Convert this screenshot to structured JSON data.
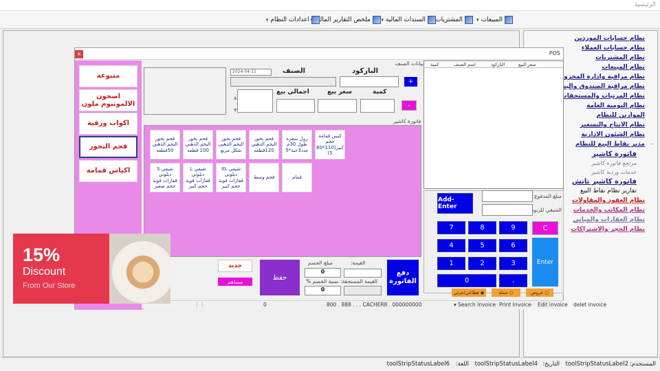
{
  "window": {
    "title": "الرئيسية"
  },
  "menu": {
    "items": [
      {
        "label": "المبيعات",
        "icon": "report-icon"
      },
      {
        "label": "المشتريات",
        "icon": "report-icon"
      },
      {
        "label": "السندات المالية",
        "icon": "report-icon"
      },
      {
        "label": "ملخص التقارير المالية",
        "icon": "report-icon"
      },
      {
        "label": "اعدادات النظام",
        "icon": "report-icon"
      }
    ]
  },
  "tree": {
    "items": [
      {
        "label": "نظام حسابات الموردين",
        "style": ""
      },
      {
        "label": "نظام حسابات العملاء",
        "style": ""
      },
      {
        "label": "نظام المشتريات",
        "style": ""
      },
      {
        "label": "نظام المبيعات",
        "style": ""
      },
      {
        "label": "نظام مراقبة وادارة المخزون",
        "style": ""
      },
      {
        "label": "نظام مراقبة الصندوق والبنوك",
        "style": ""
      },
      {
        "label": "نظام المرتبات والمستحقات",
        "style": ""
      },
      {
        "label": "نظام اليومية العامة",
        "style": ""
      },
      {
        "label": "الموازين للنظام",
        "style": ""
      },
      {
        "label": "نظام الانتاج والتسعير",
        "style": ""
      },
      {
        "label": "نظام الشئون الادارية",
        "style": ""
      },
      {
        "label": "مدير نقاط البيع للنظام",
        "style": ""
      },
      {
        "label": "فاتورة كاشير",
        "style": "sub"
      },
      {
        "label": "مرتجع فاتورة كاشير",
        "style": "sub gray"
      },
      {
        "label": "خدمات وردية كاشير",
        "style": "sub gray"
      },
      {
        "label": "فاتورة كاشير تاتش",
        "style": "sub"
      },
      {
        "label": "تقارير نظام نقاط البيع",
        "style": "sub dark"
      },
      {
        "label": "نظام العقود والمقاولات",
        "style": "red"
      },
      {
        "label": "نظام المكاتب والخدمات",
        "style": "pinkish"
      },
      {
        "label": "نظام العقارات والمباني",
        "style": "gray"
      },
      {
        "label": "نظام الحجز والاشتراكات",
        "style": "pinkish"
      }
    ]
  },
  "statusbar": {
    "user_label": "المستخدم:",
    "user_value": "toolStripStatusLabel2",
    "date_label": "التاريخ:",
    "date_value": "toolStripStatusLabel4",
    "lang_label": "اللغة:",
    "lang_value": "toolStripStatusLabel6"
  },
  "pos": {
    "title": "POS",
    "close": "×",
    "categories": [
      "متنوعة",
      "اصحون الالمونيوم ملون",
      "اكواب ورقية",
      "فحم النحور",
      "اكياس قمامة"
    ],
    "active_category": 3,
    "item_data_label": "بيانات الصنف",
    "barcode_label": "الباركود",
    "item_label": "الصنف",
    "date_value": "2024-04-11",
    "qty_label": "كمية",
    "price_label": "سعر بيع",
    "total_label": "اجمالي بيع",
    "plus_button": "+",
    "minus_button": "-",
    "invoice_label": "فاتورة كاشير",
    "products": [
      [
        "كيس قمامة حجم كبير(110*80 5)",
        "رول سفرة طول 30م عدد3حبة*5",
        "فحم بخور البحم الذهبي 120قطعه",
        "فحم بخور البحم الذهبي شكل مربع",
        "فحم بخور البحم الذهبي 100 قطعه",
        "فحم بخور البحم الذهبي 50قطعه"
      ],
      [
        "قمام",
        "فحم وسط",
        "شيفي XL ديلوني قفازات قوية حجم كبير",
        "شيفي L ديلوني قفازات قوية حجم كبير",
        "شيفي S ديلوني قفازات قوية حجم صغير"
      ]
    ],
    "grid_headers": [
      "سعر البيع",
      "الباركود",
      "اسم الصنف",
      "كمية"
    ],
    "amount_paid_label": "مبلغ المدفوع:",
    "remaining_label": "المتبقي للزبون:",
    "add_enter_button": "Add-Enter",
    "keys": [
      "7",
      "8",
      "9",
      "4",
      "5",
      "6",
      "1",
      "2",
      "3",
      "0",
      "."
    ],
    "c_button": "C",
    "enter_button": "Enter",
    "payment_options": [
      {
        "label": "قطاعي/جزئي",
        "checked": true
      },
      {
        "label": "جملة",
        "checked": false
      },
      {
        "label": "عروض",
        "checked": false
      }
    ],
    "pay_button": "دفع الفاتورة",
    "value_label": "القيمة:",
    "due_label": "القيمة المستحقة:",
    "discount_amount_label": "مبلغ الخصم",
    "discount_amount_value": "0",
    "discount_pct_label": "نسبة الخصم %",
    "discount_pct_value": "0",
    "save_button": "حفظ",
    "new_button": "جديد",
    "contribute_button": "مساهم",
    "bottom_strip": {
      "zero": "0",
      "code": "800 . 888 . . . CACHER8 . 000000000",
      "search_invoice": "Search Invoice",
      "print_invoice": "Print Invoice",
      "edit_invoice": "Edit invoice",
      "delete_invoice": "delet invoice"
    }
  },
  "promo": {
    "percent": "15%",
    "title": "Discount",
    "subtitle": "From Our Store"
  },
  "colors": {
    "pink": "#ea8ae8",
    "blue_key": "#0000e6",
    "purple_save": "#8a2fc9",
    "promo_red": "#e5384d"
  }
}
